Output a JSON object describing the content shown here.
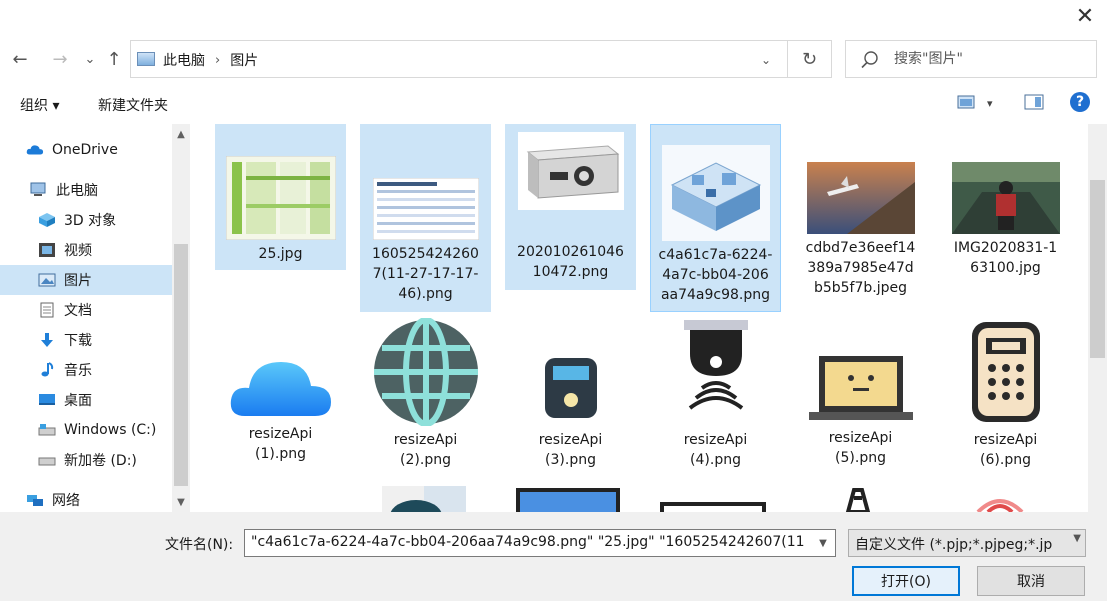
{
  "dialog": {
    "close_glyph": "✕"
  },
  "nav": {
    "back_glyph": "←",
    "forward_glyph": "→",
    "recent_glyph": "⌄",
    "up_glyph": "↑",
    "breadcrumbs": [
      "此电脑",
      "图片"
    ],
    "breadcrumb_sep": "›",
    "address_dropdown_glyph": "⌄",
    "refresh_glyph": "↻",
    "search_placeholder": "搜索\"图片\""
  },
  "toolbar": {
    "organize_label": "组织 ▾",
    "new_folder_label": "新建文件夹",
    "view_dropdown_glyph": "▾",
    "help_glyph": "?"
  },
  "sidebar": {
    "items": [
      {
        "label": "OneDrive",
        "icon": "cloud-icon"
      },
      {
        "label": "此电脑",
        "icon": "computer-icon"
      },
      {
        "label": "3D 对象",
        "icon": "cube-icon"
      },
      {
        "label": "视频",
        "icon": "film-icon"
      },
      {
        "label": "图片",
        "icon": "picture-icon",
        "selected": true
      },
      {
        "label": "文档",
        "icon": "document-icon"
      },
      {
        "label": "下载",
        "icon": "download-icon"
      },
      {
        "label": "音乐",
        "icon": "music-icon"
      },
      {
        "label": "桌面",
        "icon": "desktop-icon"
      },
      {
        "label": "Windows (C:)",
        "icon": "drive-icon"
      },
      {
        "label": "新加卷 (D:)",
        "icon": "drive-icon"
      },
      {
        "label": "网络",
        "icon": "network-icon"
      }
    ]
  },
  "files": [
    {
      "name": "25.jpg",
      "selected": true
    },
    {
      "name": "1605254242607(11-27-17-17-46).png",
      "selected": true
    },
    {
      "name": "20201026104610472.png",
      "selected": true
    },
    {
      "name": "c4a61c7a-6224-4a7c-bb04-206aa74a9c98.png",
      "selected": true,
      "focused": true
    },
    {
      "name": "cdbd7e36eef14389a7985e47db5b5f7b.jpeg",
      "selected": false
    },
    {
      "name": "IMG2020831-163100.jpg",
      "selected": false
    },
    {
      "name": "resizeApi (1).png",
      "selected": false
    },
    {
      "name": "resizeApi (2).png",
      "selected": false
    },
    {
      "name": "resizeApi (3).png",
      "selected": false
    },
    {
      "name": "resizeApi (4).png",
      "selected": false
    },
    {
      "name": "resizeApi (5).png",
      "selected": false
    },
    {
      "name": "resizeApi (6).png",
      "selected": false
    }
  ],
  "file_labels": [
    [
      "25.jpg"
    ],
    [
      "160525424260",
      "7(11-27-17-17-",
      "46).png"
    ],
    [
      "202010261046",
      "10472.png"
    ],
    [
      "c4a61c7a-6224-",
      "4a7c-bb04-206",
      "aa74a9c98.png"
    ],
    [
      "cdbd7e36eef14",
      "389a7985e47d",
      "b5b5f7b.jpeg"
    ],
    [
      "IMG2020831-1",
      "63100.jpg"
    ],
    [
      "resizeApi",
      "(1).png"
    ],
    [
      "resizeApi",
      "(2).png"
    ],
    [
      "resizeApi",
      "(3).png"
    ],
    [
      "resizeApi",
      "(4).png"
    ],
    [
      "resizeApi",
      "(5).png"
    ],
    [
      "resizeApi",
      "(6).png"
    ]
  ],
  "bottom": {
    "filename_label": "文件名(N):",
    "filename_value": "\"c4a61c7a-6224-4a7c-bb04-206aa74a9c98.png\" \"25.jpg\" \"1605254242607(11",
    "filetype_value": "自定义文件 (*.pjp;*.pjpeg;*.jp",
    "open_label": "打开(O)",
    "cancel_label": "取消"
  },
  "colors": {
    "selection": "#cce4f7",
    "selection_border": "#99d1ff",
    "accent": "#0078d7"
  }
}
